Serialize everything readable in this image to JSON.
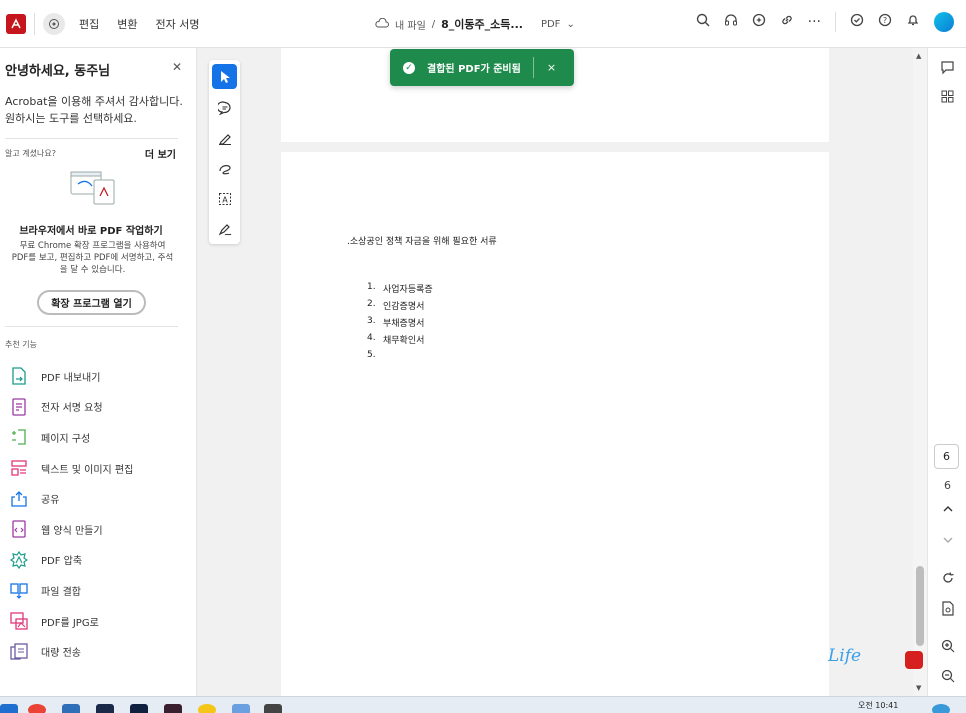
{
  "topbar": {
    "menu": [
      "편집",
      "변환",
      "전자 서명"
    ],
    "breadcrumb_folder": "내 파일",
    "breadcrumb_sep": "/",
    "filename": "8_이동주_소득...",
    "file_type": "PDF"
  },
  "left_panel": {
    "greeting": "안녕하세요, 동주님",
    "intro": "Acrobat을 이용해 주셔서 감사합니다. 원하시는 도구를 선택하세요.",
    "did_you_know": "알고 계셨나요?",
    "see_more": "더 보기",
    "promo_title": "브라우저에서 바로 PDF 작업하기",
    "promo_text": "무료 Chrome 확장 프로그램을 사용하여 PDF를 보고, 편집하고 PDF에 서명하고, 주석을 달 수 있습니다.",
    "promo_button": "확장 프로그램 열기",
    "recommended": "추천 기능",
    "tools": [
      {
        "label": "PDF 내보내기",
        "icon": "export-pdf-icon",
        "color": "#1a9c8c"
      },
      {
        "label": "전자 서명 요청",
        "icon": "request-sign-icon",
        "color": "#9b3aa5"
      },
      {
        "label": "페이지 구성",
        "icon": "organize-pages-icon",
        "color": "#4caf50"
      },
      {
        "label": "텍스트 및 이미지 편집",
        "icon": "edit-text-icon",
        "color": "#e0397b"
      },
      {
        "label": "공유",
        "icon": "share-icon",
        "color": "#1473e6"
      },
      {
        "label": "웹 양식 만들기",
        "icon": "web-form-icon",
        "color": "#9b3aa5"
      },
      {
        "label": "PDF 압축",
        "icon": "compress-pdf-icon",
        "color": "#1a9c8c"
      },
      {
        "label": "파일 결합",
        "icon": "combine-files-icon",
        "color": "#1473e6"
      },
      {
        "label": "PDF를 JPG로",
        "icon": "pdf-to-jpg-icon",
        "color": "#e0397b"
      },
      {
        "label": "대량 전송",
        "icon": "bulk-send-icon",
        "color": "#6b5aa0"
      }
    ]
  },
  "toast": {
    "message": "결합된 PDF가 준비됨",
    "close": "×"
  },
  "document": {
    "title": ".소상공인 정책 자금을 위해 필요한 서류",
    "list": [
      {
        "num": "1.",
        "text": "사업자등록증"
      },
      {
        "num": "2.",
        "text": "인감증명서"
      },
      {
        "num": "3.",
        "text": "부채증명서"
      },
      {
        "num": "4.",
        "text": "채무확인서"
      },
      {
        "num": "5.",
        "text": ""
      }
    ]
  },
  "right_rail": {
    "page_current": "6",
    "page_total": "6"
  },
  "watermark": "Life",
  "taskbar": {
    "clock_time": "오전 10:41"
  }
}
